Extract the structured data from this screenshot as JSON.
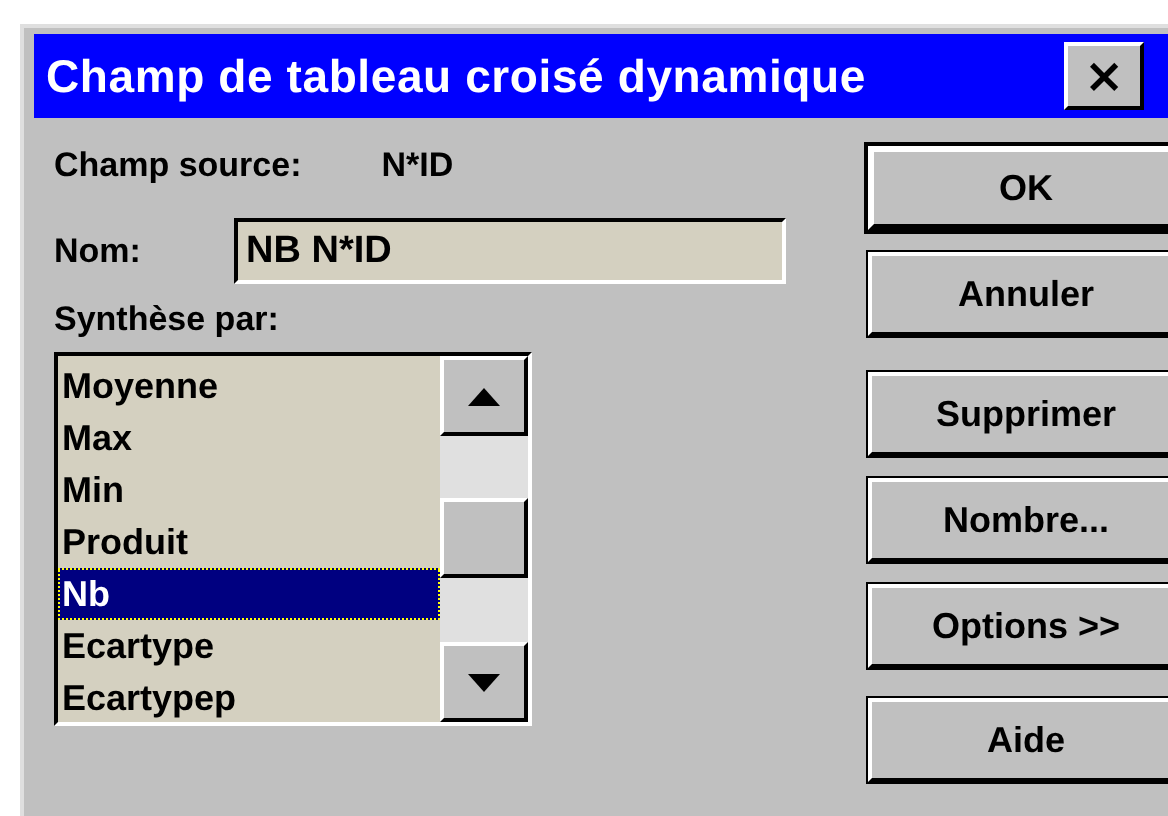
{
  "window": {
    "title": "Champ de tableau croisé dynamique",
    "close": "×"
  },
  "source": {
    "label": "Champ source:",
    "value": "N*ID"
  },
  "name_field": {
    "label": "Nom:",
    "value": "NB N*ID"
  },
  "summary": {
    "label": "Synthèse par:",
    "items": [
      {
        "label": "Moyenne",
        "selected": false
      },
      {
        "label": "Max",
        "selected": false
      },
      {
        "label": "Min",
        "selected": false
      },
      {
        "label": "Produit",
        "selected": false
      },
      {
        "label": "Nb",
        "selected": true
      },
      {
        "label": "Ecartype",
        "selected": false
      },
      {
        "label": "Ecartypep",
        "selected": false
      }
    ]
  },
  "buttons": [
    {
      "label": "OK",
      "default": true
    },
    {
      "label": "Annuler",
      "default": false
    },
    {
      "label": "Supprimer",
      "default": false
    },
    {
      "label": "Nombre...",
      "default": false
    },
    {
      "label": "Options >>",
      "default": false
    },
    {
      "label": "Aide",
      "default": false
    }
  ]
}
